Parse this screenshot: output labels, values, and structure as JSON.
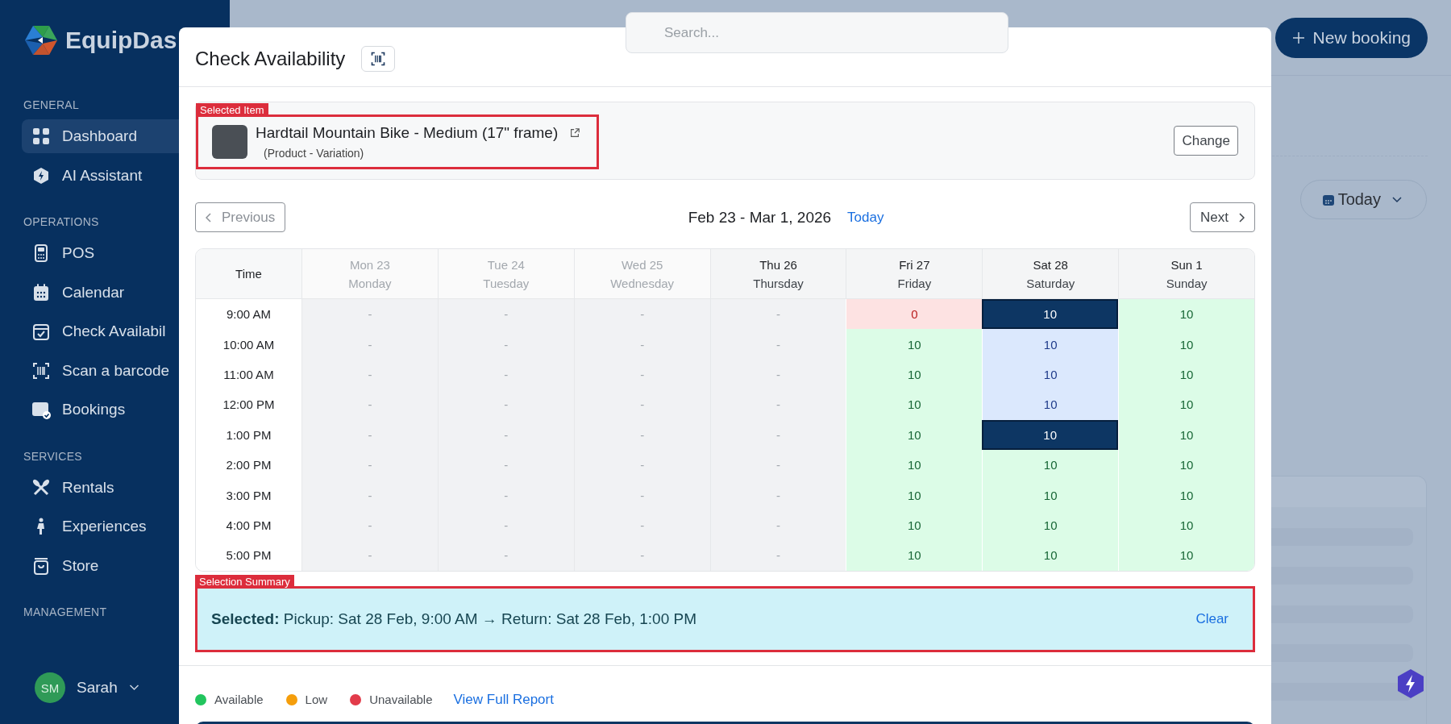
{
  "sidebar": {
    "brand": "EquipDas",
    "sections": [
      {
        "title": "GENERAL",
        "items": [
          {
            "label": "Dashboard",
            "selected": true
          },
          {
            "label": "AI Assistant",
            "selected": false
          }
        ]
      },
      {
        "title": "OPERATIONS",
        "items": [
          {
            "label": "POS",
            "selected": false
          },
          {
            "label": "Calendar",
            "selected": false
          },
          {
            "label": "Check Availabil",
            "selected": false
          },
          {
            "label": "Scan a barcode",
            "selected": false
          },
          {
            "label": "Bookings",
            "selected": false
          }
        ]
      },
      {
        "title": "SERVICES",
        "items": [
          {
            "label": "Rentals",
            "selected": false
          },
          {
            "label": "Experiences",
            "selected": false
          },
          {
            "label": "Store",
            "selected": false
          }
        ]
      },
      {
        "title": "MANAGEMENT"
      }
    ],
    "user": {
      "initials": "SM",
      "name": "Sarah"
    }
  },
  "background": {
    "new_booking": "New booking",
    "date_filter": "Today"
  },
  "search": {
    "placeholder": "Search..."
  },
  "modal": {
    "title": "Check Availability",
    "selected_item": {
      "annotation": "Selected Item",
      "name": "Hardtail Mountain Bike - Medium (17\" frame)",
      "type": "(Product - Variation)",
      "change": "Change"
    },
    "nav": {
      "previous": "Previous",
      "range": "Feb 23 - Mar 1, 2026",
      "today": "Today",
      "next": "Next"
    },
    "table": {
      "time_header": "Time",
      "times": [
        "9:00 AM",
        "10:00 AM",
        "11:00 AM",
        "12:00 PM",
        "1:00 PM",
        "2:00 PM",
        "3:00 PM",
        "4:00 PM",
        "5:00 PM"
      ],
      "days": [
        {
          "label": "Mon 23",
          "weekday": "Monday",
          "past": true,
          "slots": [
            {
              "text": "-",
              "kind": "closed"
            },
            {
              "text": "-",
              "kind": "closed"
            },
            {
              "text": "-",
              "kind": "closed"
            },
            {
              "text": "-",
              "kind": "closed"
            },
            {
              "text": "-",
              "kind": "closed"
            },
            {
              "text": "-",
              "kind": "closed"
            },
            {
              "text": "-",
              "kind": "closed"
            },
            {
              "text": "-",
              "kind": "closed"
            },
            {
              "text": "-",
              "kind": "closed"
            }
          ]
        },
        {
          "label": "Tue 24",
          "weekday": "Tuesday",
          "past": true,
          "slots": [
            {
              "text": "-",
              "kind": "closed"
            },
            {
              "text": "-",
              "kind": "closed"
            },
            {
              "text": "-",
              "kind": "closed"
            },
            {
              "text": "-",
              "kind": "closed"
            },
            {
              "text": "-",
              "kind": "closed"
            },
            {
              "text": "-",
              "kind": "closed"
            },
            {
              "text": "-",
              "kind": "closed"
            },
            {
              "text": "-",
              "kind": "closed"
            },
            {
              "text": "-",
              "kind": "closed"
            }
          ]
        },
        {
          "label": "Wed 25",
          "weekday": "Wednesday",
          "past": true,
          "slots": [
            {
              "text": "-",
              "kind": "closed"
            },
            {
              "text": "-",
              "kind": "closed"
            },
            {
              "text": "-",
              "kind": "closed"
            },
            {
              "text": "-",
              "kind": "closed"
            },
            {
              "text": "-",
              "kind": "closed"
            },
            {
              "text": "-",
              "kind": "closed"
            },
            {
              "text": "-",
              "kind": "closed"
            },
            {
              "text": "-",
              "kind": "closed"
            },
            {
              "text": "-",
              "kind": "closed"
            }
          ]
        },
        {
          "label": "Thu 26",
          "weekday": "Thursday",
          "past": false,
          "slots": [
            {
              "text": "-",
              "kind": "closed"
            },
            {
              "text": "-",
              "kind": "closed"
            },
            {
              "text": "-",
              "kind": "closed"
            },
            {
              "text": "-",
              "kind": "closed"
            },
            {
              "text": "-",
              "kind": "closed"
            },
            {
              "text": "-",
              "kind": "closed"
            },
            {
              "text": "-",
              "kind": "closed"
            },
            {
              "text": "-",
              "kind": "closed"
            },
            {
              "text": "-",
              "kind": "closed"
            }
          ]
        },
        {
          "label": "Fri 27",
          "weekday": "Friday",
          "past": false,
          "slots": [
            {
              "text": "0",
              "kind": "unavailable"
            },
            {
              "text": "10",
              "kind": "available"
            },
            {
              "text": "10",
              "kind": "available"
            },
            {
              "text": "10",
              "kind": "available"
            },
            {
              "text": "10",
              "kind": "available"
            },
            {
              "text": "10",
              "kind": "available"
            },
            {
              "text": "10",
              "kind": "available"
            },
            {
              "text": "10",
              "kind": "available"
            },
            {
              "text": "10",
              "kind": "available"
            }
          ]
        },
        {
          "label": "Sat 28",
          "weekday": "Saturday",
          "past": false,
          "slots": [
            {
              "text": "10",
              "kind": "selected"
            },
            {
              "text": "10",
              "kind": "in_range"
            },
            {
              "text": "10",
              "kind": "in_range"
            },
            {
              "text": "10",
              "kind": "in_range"
            },
            {
              "text": "10",
              "kind": "selected"
            },
            {
              "text": "10",
              "kind": "available"
            },
            {
              "text": "10",
              "kind": "available"
            },
            {
              "text": "10",
              "kind": "available"
            },
            {
              "text": "10",
              "kind": "available"
            }
          ]
        },
        {
          "label": "Sun 1",
          "weekday": "Sunday",
          "past": false,
          "slots": [
            {
              "text": "10",
              "kind": "available"
            },
            {
              "text": "10",
              "kind": "available"
            },
            {
              "text": "10",
              "kind": "available"
            },
            {
              "text": "10",
              "kind": "available"
            },
            {
              "text": "10",
              "kind": "available"
            },
            {
              "text": "10",
              "kind": "available"
            },
            {
              "text": "10",
              "kind": "available"
            },
            {
              "text": "10",
              "kind": "available"
            },
            {
              "text": "10",
              "kind": "available"
            }
          ]
        }
      ]
    },
    "summary": {
      "annotation": "Selection Summary",
      "text": "**Selected:** Pickup: Sat 28 Feb, 9:00 AM → Return: Sat 28 Feb, 1:00 PM",
      "clear": "Clear"
    },
    "legend": [
      {
        "label": "Available",
        "color": "#22c55e"
      },
      {
        "label": "Low",
        "color": "#f59e0b"
      },
      {
        "label": "Unavailable",
        "color": "#e23b4a"
      }
    ],
    "report_link": "View Full Report"
  }
}
